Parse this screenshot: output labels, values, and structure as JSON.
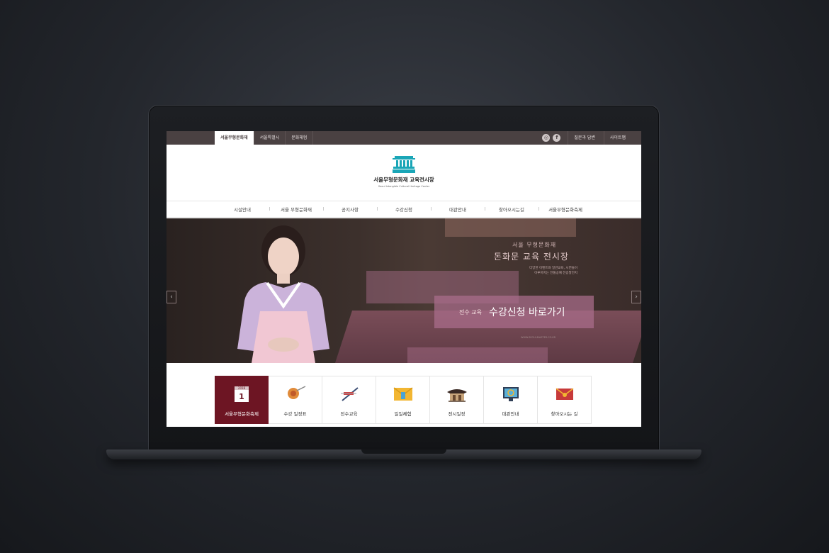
{
  "top_tabs": [
    "서울무형문화재",
    "서울특별시",
    "문화체험"
  ],
  "top_sns": [
    "instagram-icon",
    "facebook-icon"
  ],
  "top_links": [
    "질문과 답변",
    "사이트맵"
  ],
  "logo": {
    "name": "서울무형문화재 교육전시장",
    "sub": "Seoul Intangible Cultural Heritage Center"
  },
  "nav": [
    "시설안내",
    "서울 무형문화재",
    "공지사항",
    "수강신청",
    "대관안내",
    "찾아오시는길",
    "서울무형문화축제"
  ],
  "hero": {
    "slogan1": "서울 무형문화재",
    "slogan2": "돈화문 교육 전시장",
    "desc_line1": "다양한 이벤트와 일반교육, 시연들이",
    "desc_line2": "이루어지는 전통공예 전승발전지",
    "cta_sub": "전수 교육",
    "cta_main": "수강신청 바로가기",
    "url": "WWW.SEOULMASTER.CO.KR"
  },
  "quick_links": [
    {
      "label": "서울무형문화축제",
      "icon": "calendar-icon"
    },
    {
      "label": "수강 일정표",
      "icon": "craft-icon"
    },
    {
      "label": "전수교육",
      "icon": "tools-icon"
    },
    {
      "label": "일일체험",
      "icon": "envelope-icon"
    },
    {
      "label": "전시일정",
      "icon": "hanok-icon"
    },
    {
      "label": "대관안내",
      "icon": "monitor-icon"
    },
    {
      "label": "찾아오시는 길",
      "icon": "map-icon"
    }
  ],
  "calendar_year": "2018",
  "calendar_day": "1",
  "colors": {
    "accent": "#6d1523",
    "topbar": "#4a4142",
    "cta": "#aa6e8c"
  }
}
